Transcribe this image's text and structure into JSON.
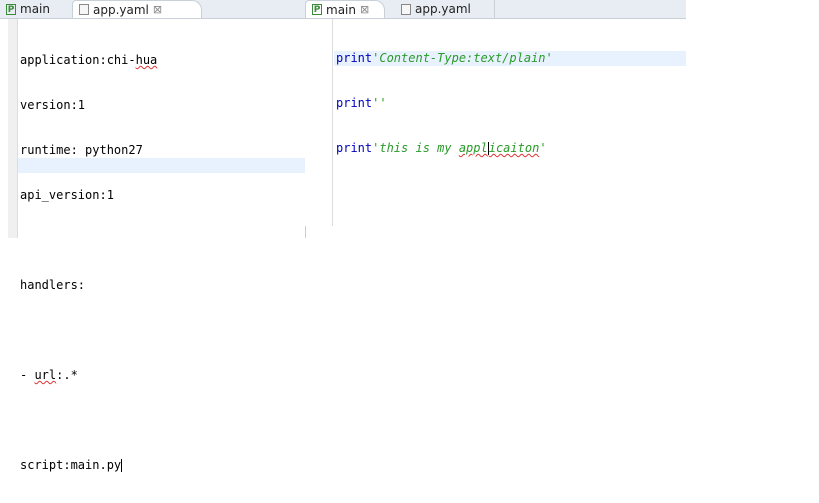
{
  "left": {
    "tabs": [
      {
        "label": "main",
        "icon": "python-file-icon"
      },
      {
        "label": "app.yaml",
        "icon": "file-icon",
        "close": "⊠"
      }
    ],
    "lines": [
      "application:chi-",
      "hua",
      "version:1",
      "runtime: python27",
      "api_version:1",
      "",
      "handlers:",
      "",
      "- ",
      "url",
      ":.*",
      "",
      "script:main.py"
    ]
  },
  "right": {
    "tabs": [
      {
        "label": "main",
        "icon": "python-file-icon",
        "close": "⊠"
      },
      {
        "label": "app.yaml",
        "icon": "file-icon"
      }
    ],
    "kw": "print",
    "s1": "'Content-Type:text/plain'",
    "s2": "''",
    "s3a": "'this is my ",
    "s3b": "appl",
    "s3c": "icaiton",
    "s3d": "'"
  }
}
